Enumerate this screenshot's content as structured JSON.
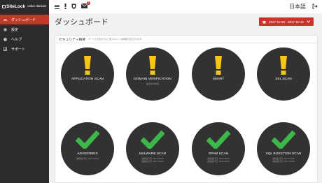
{
  "header": {
    "logo_text": "SiteLock",
    "partner_text": "value-domain",
    "lang": "日本語"
  },
  "sidebar": {
    "items": [
      {
        "label": "ダッシュボード",
        "icon": "dashboard-icon",
        "active": true
      },
      {
        "label": "設定",
        "icon": "gear-icon",
        "active": false
      },
      {
        "label": "ヘルプ",
        "icon": "help-icon",
        "active": false
      },
      {
        "label": "サポート",
        "icon": "support-icon",
        "active": false
      }
    ]
  },
  "topbar": {
    "notification_count": "2"
  },
  "main": {
    "title": "ダッシュボード",
    "date_range": "2017-10-06 - 2017-10-12"
  },
  "panel": {
    "title": "セキュリティ概要",
    "subtitle": "カーソルを合わせると各スキャン の詳細が表示されます。",
    "cards": [
      {
        "label": "APPLICATION SCAN",
        "status": "warning",
        "sub1": "",
        "sub2": ""
      },
      {
        "label": "DOMAIN VERIFICATION",
        "status": "warning",
        "sub1": "設定中の状態",
        "sub2": ""
      },
      {
        "label": "SMART",
        "status": "warning",
        "sub1": "",
        "sub2": ""
      },
      {
        "label": "SSL SCAN",
        "status": "warning",
        "sub1": "",
        "sub2": ""
      },
      {
        "label": "ADVISORIES",
        "status": "ok",
        "sub1": "最終実行日: 2017/10/12",
        "sub2": ""
      },
      {
        "label": "MALWARE SCAN",
        "status": "ok",
        "sub1": "最終実行日: 2017/10/12",
        "sub2": "最終実行日: 2017/10/12"
      },
      {
        "label": "SPAM SCAN",
        "status": "ok",
        "sub1": "最終実行日: 2017/10/12",
        "sub2": "最終実行日: 2017/10/12"
      },
      {
        "label": "SQL INJECTION SCAN",
        "status": "ok",
        "sub1": "最終実行日: 2017/10/12",
        "sub2": "最終実行日: 2017/10/12"
      }
    ]
  },
  "colors": {
    "accent": "#c0392b",
    "warning": "#f5c518",
    "ok": "#3cb84a",
    "sidebar": "#2b2b2b",
    "card": "#323232"
  }
}
